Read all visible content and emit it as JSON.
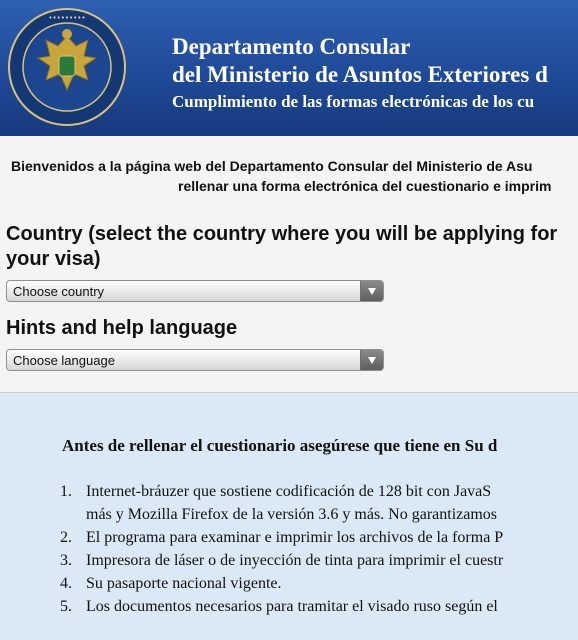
{
  "header": {
    "line1": "Departamento Consular",
    "line2": "del Ministerio de Asuntos Exteriores d",
    "line3": "Cumplimiento de las formas electrónicas de los cu",
    "seal_icon": "consular-department-seal",
    "colors": {
      "header_bg": "#1f4a98",
      "info_bg": "#dbe9f6"
    }
  },
  "welcome": {
    "line1": "Bienvenidos a la página web del Departamento Consular del Ministerio de Asu",
    "line2": "rellenar una forma electrónica del cuestionario e imprim"
  },
  "form": {
    "country_label": "Country (select the country where you will be applying for your visa)",
    "country_select": "Choose country",
    "language_label": "Hints and help language",
    "language_select": "Choose language"
  },
  "info": {
    "title": "Antes de rellenar el cuestionario asegúrese que tiene en Su d",
    "items": [
      {
        "num": "1.",
        "line1": "Internet-bráuzer que sostiene codificación de 128 bit con JavaS",
        "line2": "más y Mozilla Firefox de la versión 3.6 y más. No garantizamos"
      },
      {
        "num": "2.",
        "line1": "El programa para examinar e imprimir los archivos de la forma P"
      },
      {
        "num": "3.",
        "line1": "Impresora de láser o de inyección de tinta para imprimir el cuestr"
      },
      {
        "num": "4.",
        "line1": "Su pasaporte nacional vigente."
      },
      {
        "num": "5.",
        "line1": "Los documentos necesarios para tramitar el visado ruso según el"
      }
    ]
  }
}
